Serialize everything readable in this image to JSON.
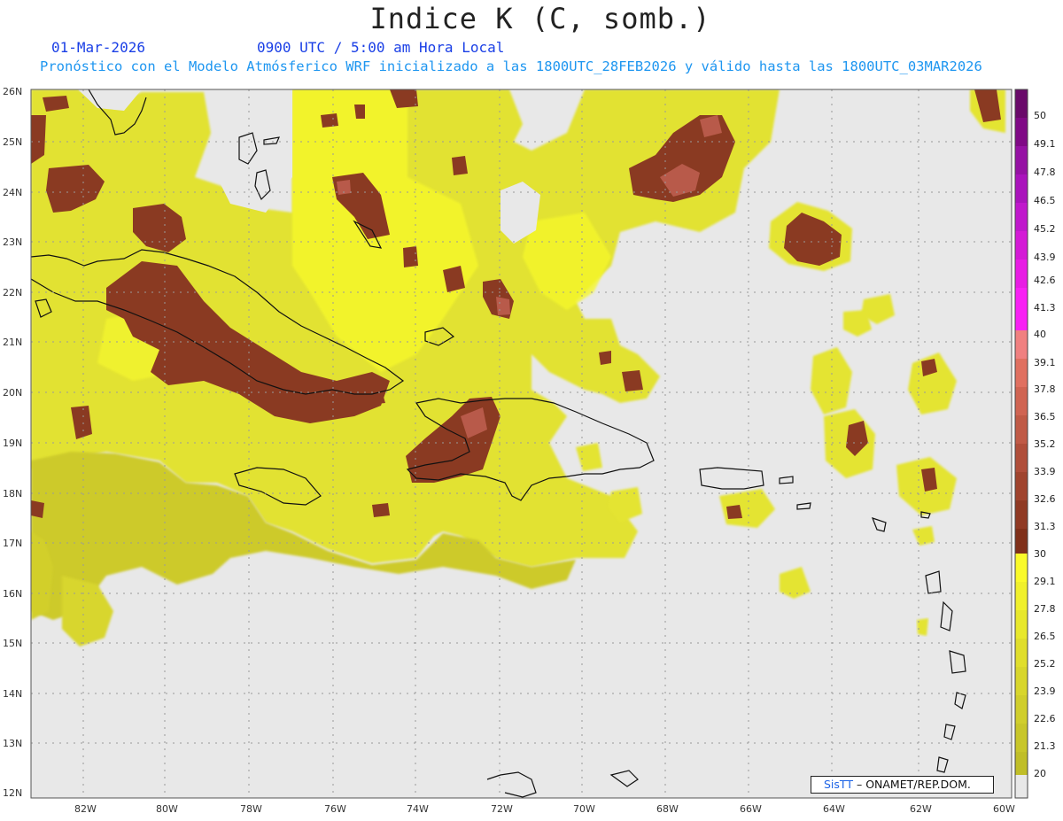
{
  "header": {
    "title": "Indice K (C, somb.)",
    "date": "01-Mar-2026",
    "time": "0900 UTC / 5:00 am Hora Local",
    "forecast": "Pronóstico con el Modelo Atmósferico WRF inicializado a las 1800UTC_28FEB2026 y válido hasta las  1800UTC_03MAR2026"
  },
  "axes": {
    "lat_labels": [
      "26N",
      "25N",
      "24N",
      "23N",
      "22N",
      "21N",
      "20N",
      "19N",
      "18N",
      "17N",
      "16N",
      "15N",
      "14N",
      "13N",
      "12N"
    ],
    "lon_labels": [
      "82W",
      "80W",
      "78W",
      "76W",
      "74W",
      "72W",
      "70W",
      "68W",
      "66W",
      "64W",
      "62W",
      "60W"
    ]
  },
  "colorbar": {
    "labels": [
      "50",
      "49.1",
      "47.8",
      "46.5",
      "45.2",
      "43.9",
      "42.6",
      "41.3",
      "40",
      "39.1",
      "37.8",
      "36.5",
      "35.2",
      "33.9",
      "32.6",
      "31.3",
      "30",
      "29.1",
      "27.8",
      "26.5",
      "25.2",
      "23.9",
      "22.6",
      "21.3",
      "20"
    ],
    "colors": {
      "40-50": "#c800d8",
      "30-40": "#b8554a",
      "20-30": "#e6e62a",
      "below": "#e6e6e6"
    }
  },
  "map": {
    "colors": {
      "background": "#e8e8e8",
      "k_yellow": "#e4e432",
      "k_yellow_bright": "#f6f82a",
      "k_olive": "#c8c42a",
      "k_brown": "#8c3a22",
      "k_brown_light": "#b45040",
      "coast": "#111111"
    }
  },
  "credit": {
    "logo": "SisTT",
    "text": "– ONAMET/REP.DOM."
  }
}
